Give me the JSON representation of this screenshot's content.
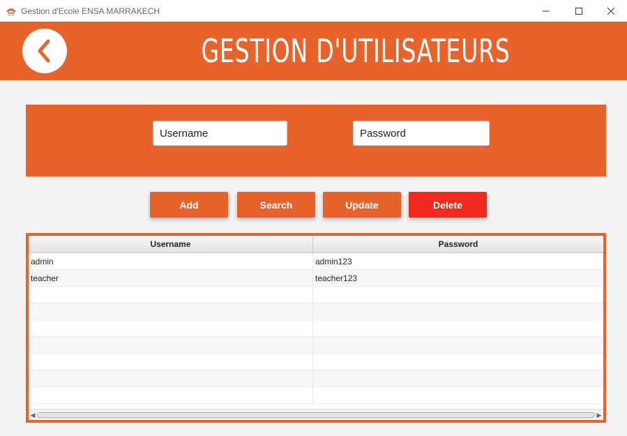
{
  "window": {
    "title": "Gestion d'Ecole ENSA MARRAKECH",
    "controls": {
      "minimize": "—",
      "maximize": "☐",
      "close": "✕"
    }
  },
  "header": {
    "title": "GESTION D'UTILISATEURS",
    "back_icon": "chevron-left-icon",
    "accent_color": "#e8632c"
  },
  "form": {
    "username_placeholder": "Username",
    "password_placeholder": "Password"
  },
  "actions": {
    "add": "Add",
    "search": "Search",
    "update": "Update",
    "delete": "Delete",
    "delete_color": "#f02a1d"
  },
  "table": {
    "columns": [
      "Username",
      "Password"
    ],
    "rows": [
      {
        "username": "admin",
        "password": "admin123"
      },
      {
        "username": "teacher",
        "password": "teacher123"
      }
    ]
  }
}
